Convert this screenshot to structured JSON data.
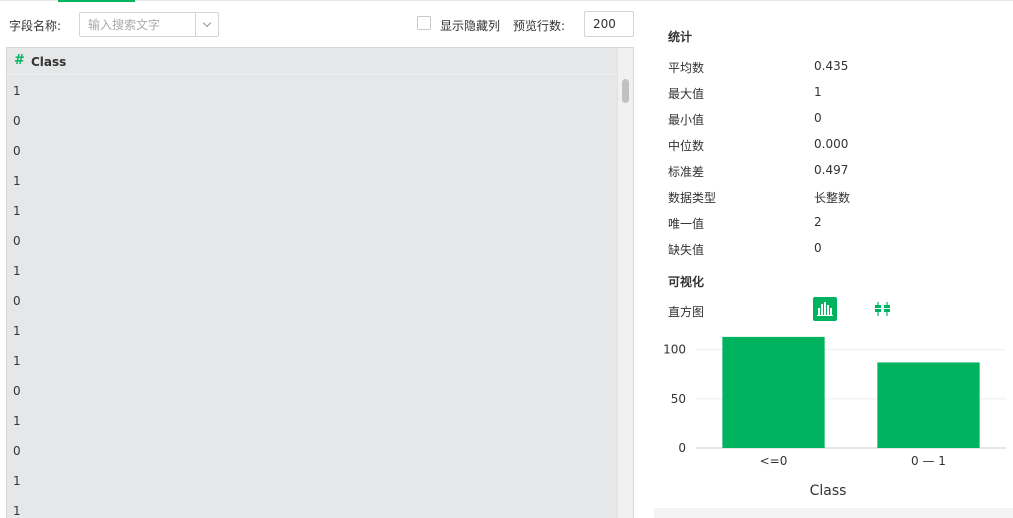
{
  "toolbar": {
    "field_label": "字段名称:",
    "search_placeholder": "输入搜索文字",
    "show_hidden_label": "显示隐藏列",
    "preview_rows_label": "预览行数:",
    "preview_rows_value": "200"
  },
  "grid": {
    "hash_icon": "#",
    "column": "Class",
    "rows": [
      "1",
      "0",
      "0",
      "1",
      "1",
      "0",
      "1",
      "0",
      "1",
      "1",
      "0",
      "1",
      "0",
      "1",
      "1"
    ]
  },
  "stats": {
    "title": "统计",
    "items": [
      {
        "k": "平均数",
        "v": "0.435"
      },
      {
        "k": "最大值",
        "v": "1"
      },
      {
        "k": "最小值",
        "v": "0"
      },
      {
        "k": "中位数",
        "v": "0.000"
      },
      {
        "k": "标准差",
        "v": "0.497"
      },
      {
        "k": "数据类型",
        "v": "长整数"
      },
      {
        "k": "唯一值",
        "v": "2"
      },
      {
        "k": "缺失值",
        "v": "0"
      }
    ]
  },
  "viz": {
    "title": "可视化",
    "histogram_label": "直方图"
  },
  "colors": {
    "accent": "#00b35f"
  },
  "chart_data": {
    "type": "bar",
    "categories": [
      "<=0",
      "0 — 1"
    ],
    "values": [
      113,
      87
    ],
    "xlabel": "Class",
    "ylabel": "",
    "yticks": [
      0,
      50,
      100
    ],
    "ylim": [
      0,
      120
    ],
    "color": "#00b35f",
    "grid": true
  }
}
